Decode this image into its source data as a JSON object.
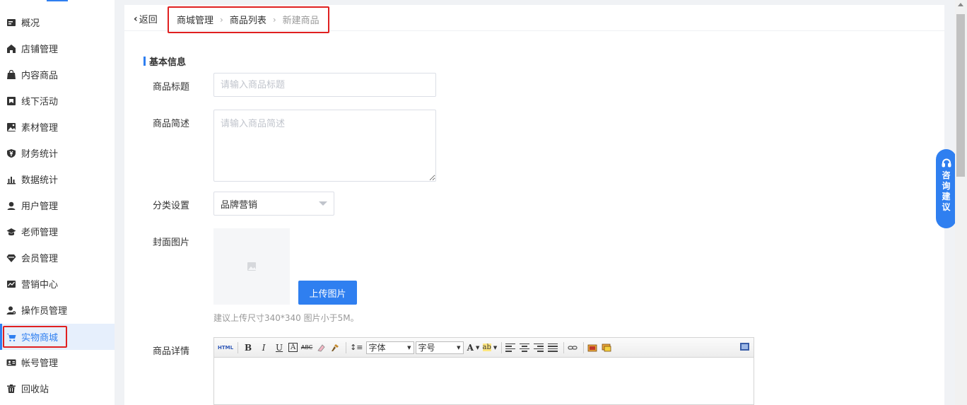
{
  "sidebar": {
    "items": [
      {
        "label": "概况",
        "icon": "overview-icon"
      },
      {
        "label": "店铺管理",
        "icon": "store-icon"
      },
      {
        "label": "内容商品",
        "icon": "bag-icon"
      },
      {
        "label": "线下活动",
        "icon": "flag-icon"
      },
      {
        "label": "素材管理",
        "icon": "image-icon"
      },
      {
        "label": "财务统计",
        "icon": "yuan-shield-icon"
      },
      {
        "label": "数据统计",
        "icon": "bar-chart-icon"
      },
      {
        "label": "用户管理",
        "icon": "user-icon"
      },
      {
        "label": "老师管理",
        "icon": "graduation-cap-icon"
      },
      {
        "label": "会员管理",
        "icon": "diamond-icon"
      },
      {
        "label": "营销中心",
        "icon": "trend-chart-icon"
      },
      {
        "label": "操作员管理",
        "icon": "operator-icon"
      },
      {
        "label": "实物商城",
        "icon": "cart-icon",
        "active": true
      },
      {
        "label": "帐号管理",
        "icon": "id-card-icon"
      },
      {
        "label": "回收站",
        "icon": "trash-icon"
      }
    ]
  },
  "topbar": {
    "back_label": "返回",
    "breadcrumb": [
      "商城管理",
      "商品列表",
      "新建商品"
    ]
  },
  "form": {
    "section_title": "基本信息",
    "title_label": "商品标题",
    "title_placeholder": "请输入商品标题",
    "desc_label": "商品简述",
    "desc_placeholder": "请输入商品简述",
    "category_label": "分类设置",
    "category_value": "品牌营销",
    "cover_label": "封面图片",
    "upload_label": "上传图片",
    "cover_hint": "建议上传尺寸340*340 图片小于5M。",
    "detail_label": "商品详情"
  },
  "editor": {
    "html_label": "HTML",
    "bold": "B",
    "italic": "I",
    "underline": "U",
    "font_color": "A",
    "strike": "ABC",
    "font_family": "字体",
    "font_size": "字号",
    "text_color": "A",
    "highlight": "ab"
  },
  "consult": {
    "label": "咨询建议"
  },
  "colors": {
    "accent": "#2f7ff0",
    "highlight_box": "#e02020"
  }
}
